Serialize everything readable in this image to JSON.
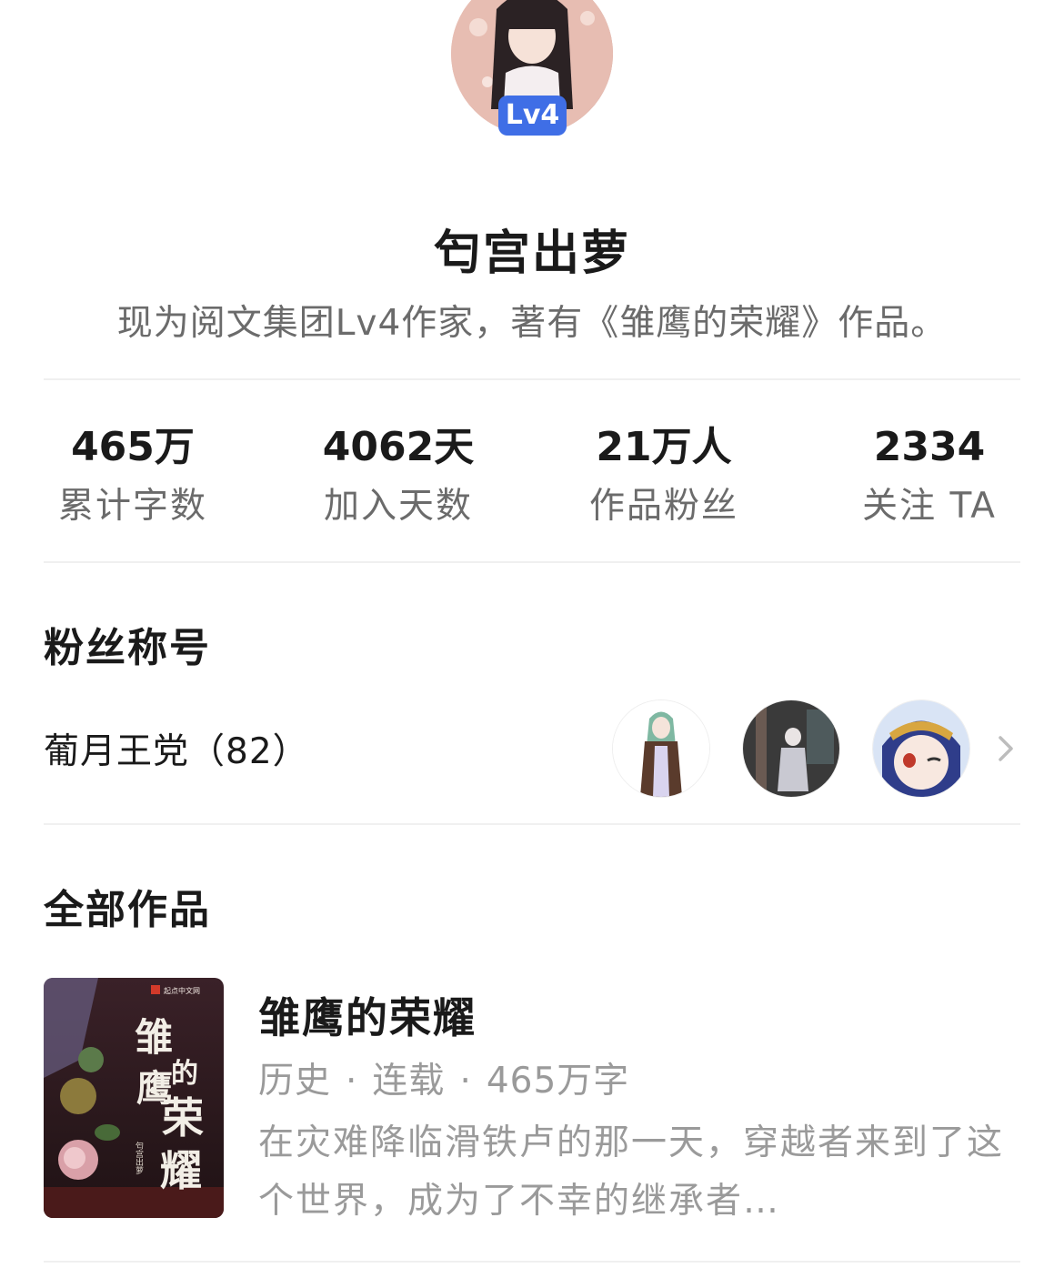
{
  "profile": {
    "level_badge": "Lv4",
    "name": "匄宫出萝",
    "intro": "现为阅文集团Lv4作家，著有《雏鹰的荣耀》作品。"
  },
  "stats": [
    {
      "value": "465万",
      "label": "累计字数"
    },
    {
      "value": "4062天",
      "label": "加入天数"
    },
    {
      "value": "21万人",
      "label": "作品粉丝"
    },
    {
      "value": "2334",
      "label": "关注 TA"
    }
  ],
  "fan_title_section": {
    "heading": "粉丝称号",
    "title_text": "葡月王党（82）",
    "avatar_icons": [
      "fan-avatar-1",
      "fan-avatar-2",
      "fan-avatar-3"
    ]
  },
  "works_section": {
    "heading": "全部作品",
    "books": [
      {
        "title": "雏鹰的荣耀",
        "genre": "历史",
        "status": "连载",
        "word_count": "465万字",
        "separator": "·",
        "description": "在灾难降临滑铁卢的那一天，穿越者来到了这个世界，成为了不幸的继承者…",
        "cover_publisher": "起点中文网",
        "cover_title": "雏鹰的荣耀",
        "cover_author": "匄宫出萝"
      }
    ]
  },
  "colors": {
    "badge_blue": "#3f6ee6",
    "text_primary": "#1a1a1a",
    "text_secondary": "#6b6b6b",
    "text_muted": "#9a9a9a",
    "divider": "#f0f0f0"
  }
}
